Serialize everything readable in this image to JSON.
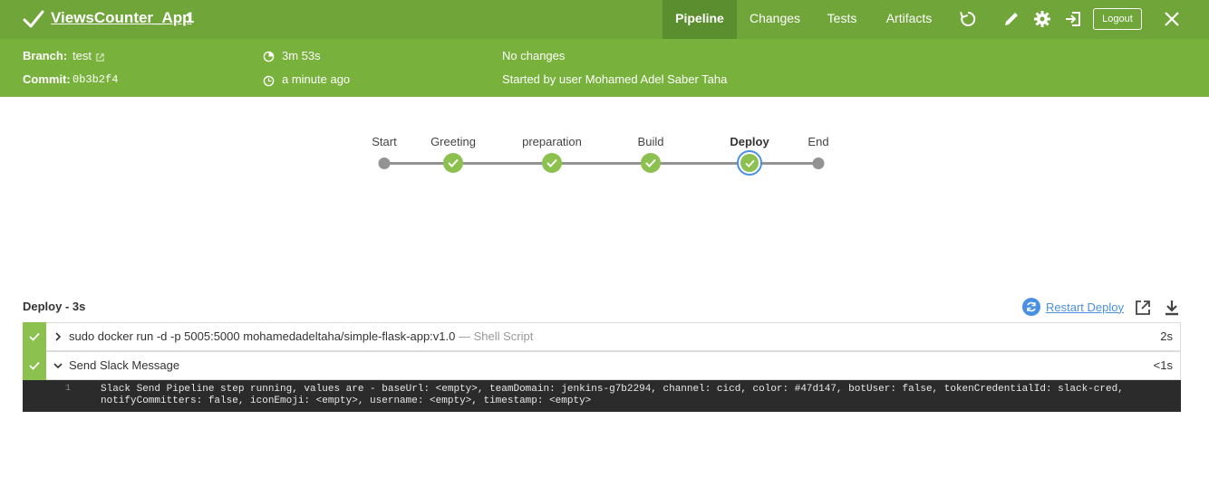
{
  "header": {
    "title": "ViewsCounter_App",
    "run_number": "1",
    "tabs": [
      {
        "label": "Pipeline",
        "active": true
      },
      {
        "label": "Changes",
        "active": false
      },
      {
        "label": "Tests",
        "active": false
      },
      {
        "label": "Artifacts",
        "active": false
      }
    ],
    "logout_label": "Logout",
    "icons": [
      "replay-icon",
      "edit-icon",
      "settings-icon",
      "exit-icon",
      "close-icon"
    ],
    "bg_color": "#6fa539",
    "active_tab_color": "#5a8e2e"
  },
  "run_info": {
    "branch_label": "Branch:",
    "branch_value": "test",
    "commit_label": "Commit:",
    "commit_value": "0b3b2f4",
    "duration": "3m 53s",
    "started_ago": "a minute ago",
    "changes": "No changes",
    "started_by": "Started by user Mohamed Adel Saber Taha",
    "bg_color": "#78b13b"
  },
  "pipeline": {
    "stages": [
      {
        "label": "Start",
        "state": "start"
      },
      {
        "label": "Greeting",
        "state": "success"
      },
      {
        "label": "preparation",
        "state": "success"
      },
      {
        "label": "Build",
        "state": "success"
      },
      {
        "label": "Deploy",
        "state": "success",
        "selected": true
      },
      {
        "label": "End",
        "state": "end"
      }
    ],
    "success_color": "#8cc04f",
    "selected_color": "#4a90e2"
  },
  "steps_panel": {
    "title": "Deploy - 3s",
    "restart_label": "Restart Deploy",
    "steps": [
      {
        "name": "sudo docker run -d -p 5005:5000 mohamedadeltaha/simple-flask-app:v1.0",
        "type": "— Shell Script",
        "duration": "2s",
        "expanded": false
      },
      {
        "name": "Send Slack Message",
        "type": "",
        "duration": "<1s",
        "expanded": true
      }
    ],
    "log": {
      "line_number": "1",
      "text": "Slack Send Pipeline step running, values are - baseUrl: <empty>, teamDomain: jenkins-g7b2294, channel: cicd, color: #47d147, botUser: false, tokenCredentialId: slack-cred,\nnotifyCommitters: false, iconEmoji: <empty>, username: <empty>, timestamp: <empty>"
    }
  }
}
